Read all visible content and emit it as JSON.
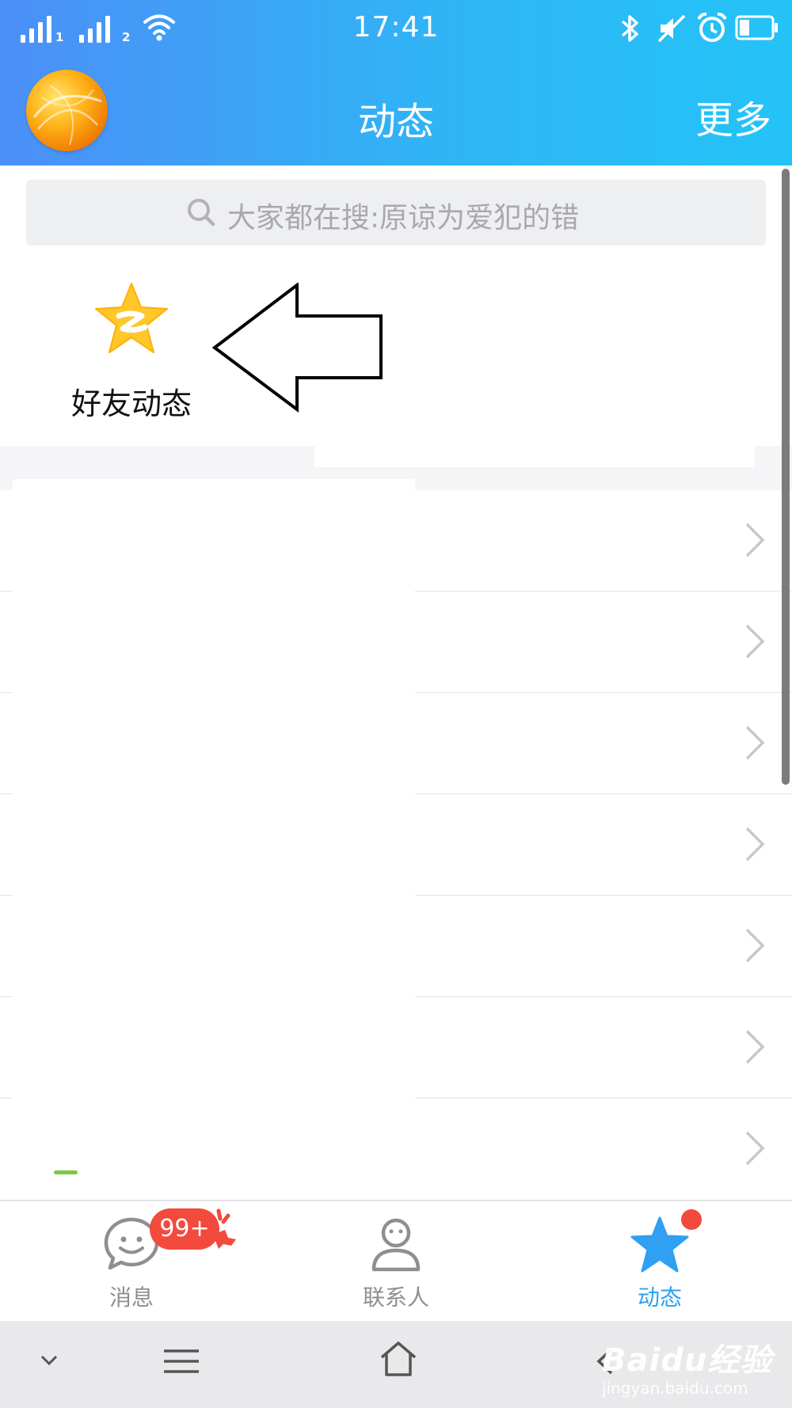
{
  "status_bar": {
    "sim1": "1",
    "sim2": "2",
    "time": "17:41",
    "icons": [
      "signal-icon",
      "wifi-icon",
      "bluetooth-icon",
      "mute-icon",
      "alarm-icon",
      "battery-icon"
    ]
  },
  "nav": {
    "title": "动态",
    "more": "更多"
  },
  "search": {
    "placeholder": "大家都在搜:原谅为爱犯的错"
  },
  "feed_entry": {
    "label": "好友动态",
    "icon": "qzone-star-icon"
  },
  "list": {
    "row_count": 7
  },
  "tabbar": {
    "tabs": [
      {
        "label": "消息",
        "icon": "message-smile-icon",
        "badge": "99+"
      },
      {
        "label": "联系人",
        "icon": "contact-person-icon"
      },
      {
        "label": "动态",
        "icon": "star-icon",
        "active": true
      }
    ]
  },
  "watermark": {
    "main": "Baidu经验",
    "sub": "jingyan.baidu.com"
  },
  "colors": {
    "header_start": "#4c8ff7",
    "header_end": "#24c3f7",
    "accent": "#2fa0f2",
    "badge": "#f24a3d",
    "star": "#ffc72c"
  }
}
